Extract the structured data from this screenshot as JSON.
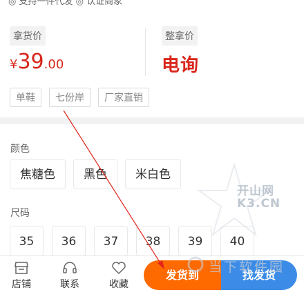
{
  "top_strip": {
    "text": "◎ 支持一件代发 ◎ 认证商家"
  },
  "price": {
    "pickup_label": "拿货价",
    "pickup_currency": "¥",
    "pickup_integer": "39",
    "pickup_decimal": ".00",
    "bulk_label": "整拿价",
    "bulk_value": "电询"
  },
  "tags": [
    "单鞋",
    "七份岸",
    "厂家直销"
  ],
  "specs": {
    "color_title": "颜色",
    "colors": [
      "焦糖色",
      "黑色",
      "米白色"
    ],
    "size_title": "尺码",
    "sizes": [
      "35",
      "36",
      "37",
      "38",
      "39",
      "40"
    ]
  },
  "toolbar": {
    "shop_label": "店铺",
    "contact_label": "联系",
    "favorite_label": "收藏",
    "ship_button": "发货到",
    "find_button": "找发货"
  },
  "watermarks": {
    "brand_line1": "开山网",
    "brand_line2": "K3.CN",
    "site": "当下软件园"
  },
  "colors": {
    "price_red": "#d8261c",
    "ship_orange": "#ff6a00",
    "find_blue": "#3c8ce7",
    "annotation_arrow": "#e0241b"
  }
}
